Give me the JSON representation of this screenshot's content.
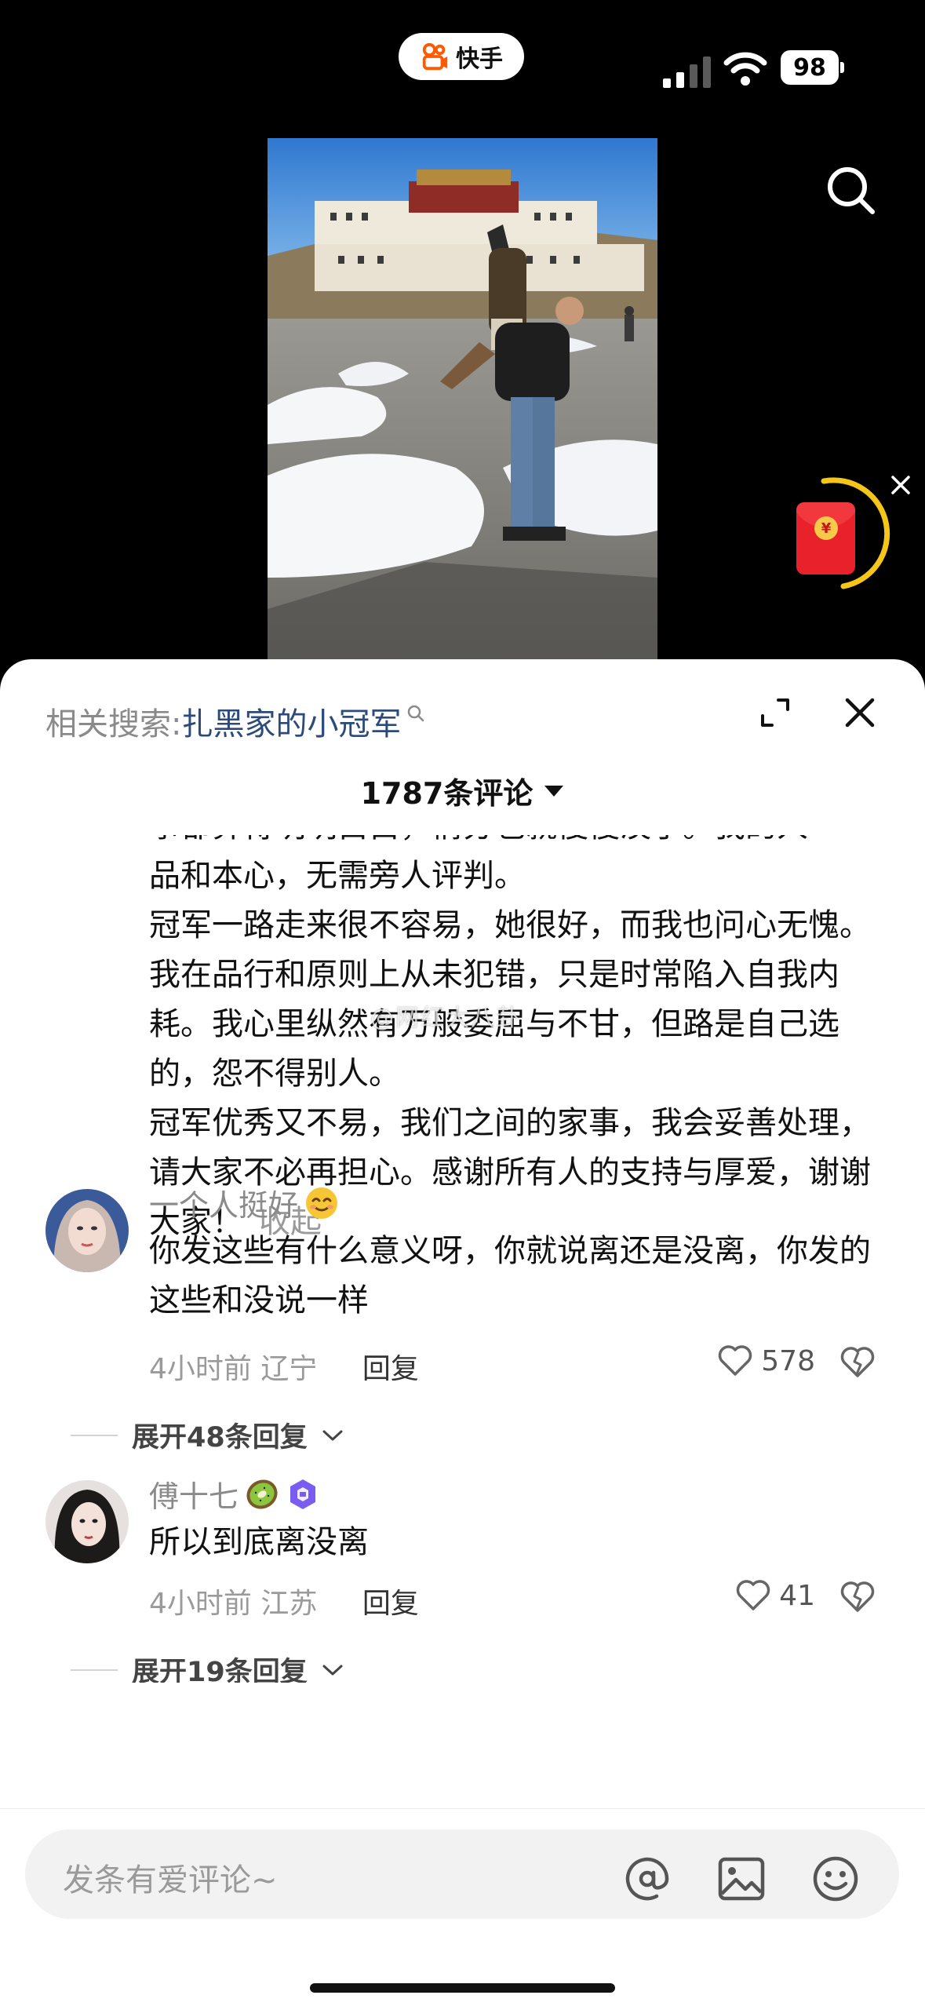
{
  "app": {
    "name": "快手"
  },
  "status_bar": {
    "battery": "98"
  },
  "sheet": {
    "related_label": "相关搜索:",
    "related_term": "扎黑家的小冠军",
    "comment_count": "1787条评论"
  },
  "post": {
    "partial_top": "事都算得明明白白，情分也就慢慢淡了。我的人",
    "body": "品和本心，无需旁人评判。\n冠军一路走来很不容易，她很好，而我也问心无愧。我在品行和原则上从未犯错，只是时常陷入自我内耗。我心里纵然有万般委屈与不甘，但路是自己选的，怨不得别人。\n冠军优秀又不易，我们之间的家事，我会妥善处理，请大家不必再担心。感谢所有人的支持与厚爱，谢谢大家！",
    "collapse_label": "收起"
  },
  "comments": [
    {
      "name": "一个人挺好",
      "name_emoji": "smiling-face-icon",
      "text": "你发这些有什么意义呀，你就说离还是没离，你发的这些和没说一样",
      "time": "4小时前",
      "region": "辽宁",
      "reply_label": "回复",
      "likes": "578",
      "expand_label": "展开48条回复"
    },
    {
      "name": "傅十七",
      "name_emoji": "kiwi-icon",
      "text": "所以到底离没离",
      "time": "4小时前",
      "region": "江苏",
      "reply_label": "回复",
      "likes": "41",
      "expand_label": "展开19条回复"
    }
  ],
  "watermark": "@网红大八卦",
  "input": {
    "placeholder": "发条有爱评论~"
  },
  "colors": {
    "accent_orange": "#ff5a00",
    "link_blue": "#2c4a7a",
    "red_packet": "#e8212a",
    "ring_yellow": "#f5c518"
  }
}
